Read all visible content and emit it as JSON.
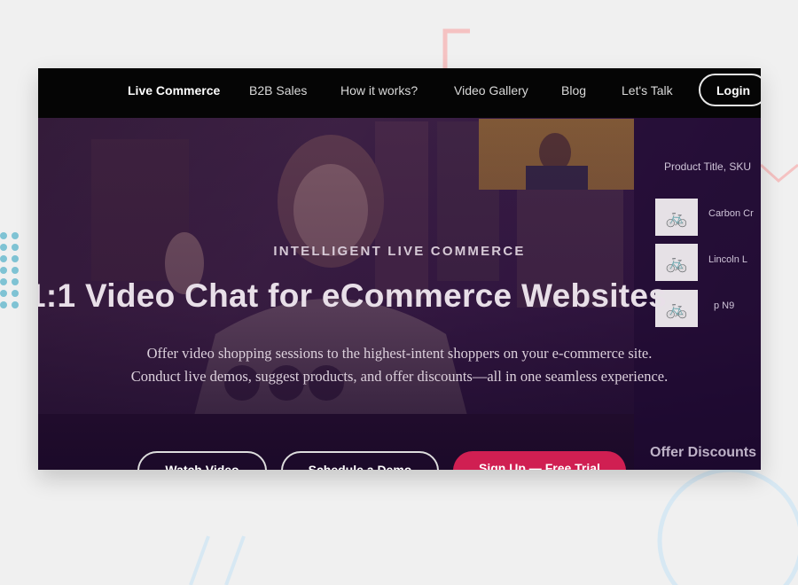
{
  "nav": {
    "items": [
      {
        "label": "Live Commerce",
        "active": true
      },
      {
        "label": "B2B Sales",
        "active": false
      },
      {
        "label": "How it works?",
        "active": false
      },
      {
        "label": "Video Gallery",
        "active": false
      },
      {
        "label": "Blog",
        "active": false
      },
      {
        "label": "Let's Talk",
        "active": false
      }
    ],
    "login_label": "Login"
  },
  "hero": {
    "eyebrow": "INTELLIGENT LIVE COMMERCE",
    "headline": "1:1 Video Chat for eCommerce Websites",
    "subtitle_line1": "Offer video shopping sessions to the highest-intent shoppers on your e-commerce site.",
    "subtitle_line2": "Conduct live demos, suggest products, and offer discounts—all in one seamless experience.",
    "buttons": {
      "watch_video": "Watch Video",
      "schedule_demo": "Schedule a Demo",
      "sign_up": "Sign Up — Free Trial"
    }
  },
  "background_panel": {
    "search_placeholder": "Product Title, SKU",
    "products": [
      "Carbon Cr",
      "Lincoln L",
      "p N9"
    ],
    "offer_label": "Offer Discounts"
  },
  "colors": {
    "accent": "#d01f52",
    "dots": "#7fc3d4",
    "deco_pink": "#f5b8b8",
    "deco_blue": "#d4e6f2"
  }
}
